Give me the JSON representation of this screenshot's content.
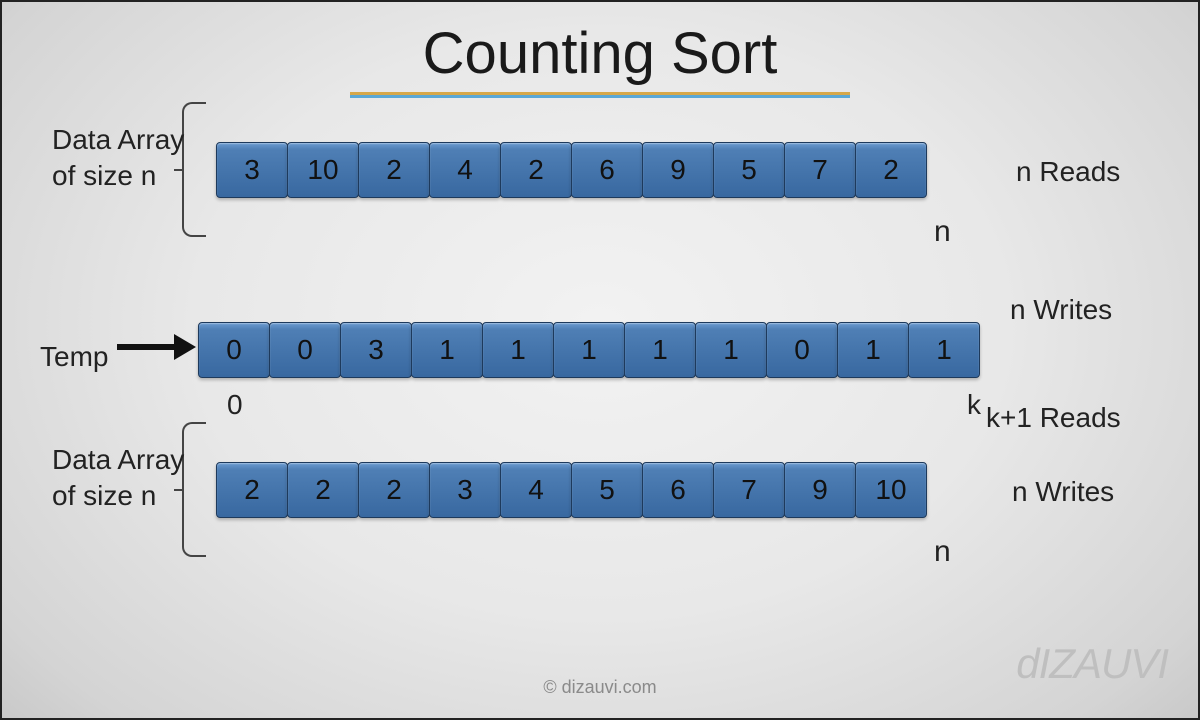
{
  "title": "Counting Sort",
  "row1": {
    "label_left": "Data Array of size n",
    "label_right": "n Reads",
    "index_label": "n",
    "cells": [
      "3",
      "10",
      "2",
      "4",
      "2",
      "6",
      "9",
      "5",
      "7",
      "2"
    ]
  },
  "row2": {
    "label_left": "Temp",
    "label_right_top": "n Writes",
    "label_right_bottom": "k+1 Reads",
    "index_start": "0",
    "index_end": "k",
    "cells": [
      "0",
      "0",
      "3",
      "1",
      "1",
      "1",
      "1",
      "1",
      "0",
      "1",
      "1"
    ]
  },
  "row3": {
    "label_left": "Data Array of size n",
    "label_right": "n Writes",
    "index_label": "n",
    "cells": [
      "2",
      "2",
      "2",
      "3",
      "4",
      "5",
      "6",
      "7",
      "9",
      "10"
    ]
  },
  "credit": "© dizauvi.com",
  "logo": "dIZAUVI"
}
